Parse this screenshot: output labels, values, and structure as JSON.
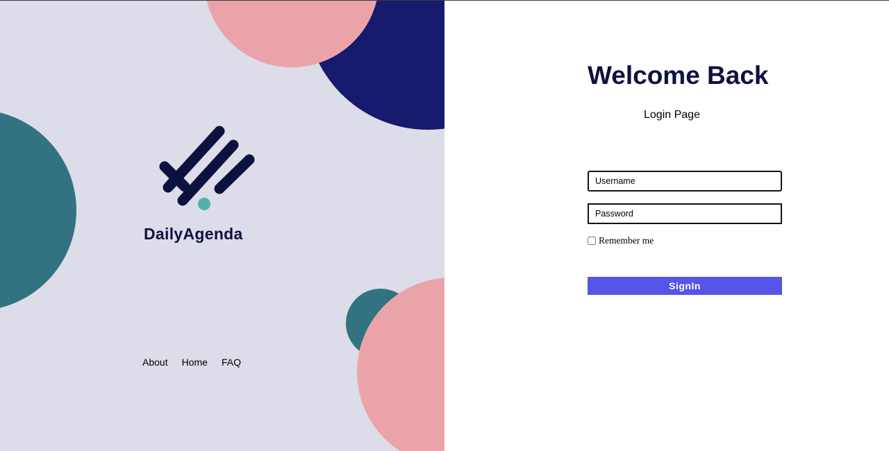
{
  "brand": {
    "name": "DailyAgenda",
    "colors": {
      "navy": "#0d1140",
      "teal_dot": "#4fb3a8"
    }
  },
  "footer_nav": [
    {
      "label": "About"
    },
    {
      "label": "Home"
    },
    {
      "label": "FAQ"
    }
  ],
  "login": {
    "title": "Welcome Back",
    "subtitle": "Login Page",
    "username": {
      "placeholder": "Username",
      "value": ""
    },
    "password": {
      "placeholder": "Password",
      "value": ""
    },
    "remember_label": "Remember me",
    "remember_checked": false,
    "submit_label": "SignIn"
  },
  "theme": {
    "left_background": "#dcdde8",
    "navy_circle": "#151a6d",
    "pink_circle": "#eaa4a9",
    "teal_circle": "#337381",
    "button_color": "#5555e8"
  }
}
